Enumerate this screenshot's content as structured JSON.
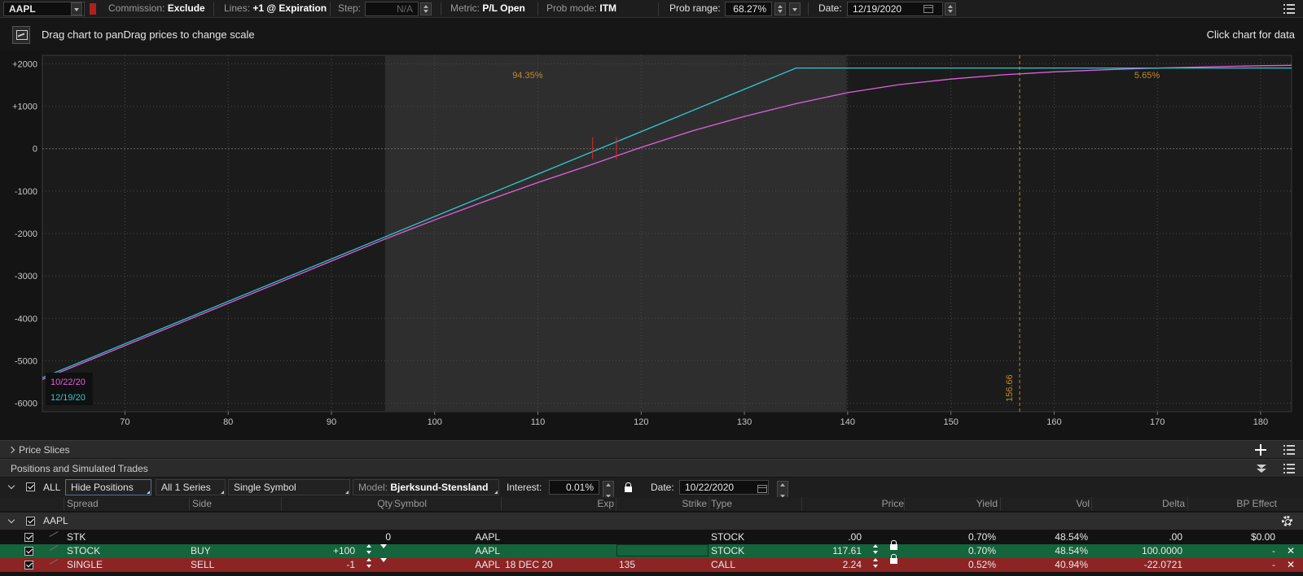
{
  "toolbar": {
    "symbol": "AAPL",
    "commission_label": "Commission:",
    "commission_value": "Exclude",
    "lines_label": "Lines:",
    "lines_value": "+1 @ Expiration",
    "step_label": "Step:",
    "step_value": "N/A",
    "metric_label": "Metric:",
    "metric_value": "P/L Open",
    "probmode_label": "Prob mode:",
    "probmode_value": "ITM",
    "probrange_label": "Prob range:",
    "probrange_value": "68.27%",
    "date_label": "Date:",
    "date_value": "12/19/2020"
  },
  "hint": {
    "left": "Drag chart to panDrag prices to change scale",
    "right": "Click chart for data"
  },
  "chart_data": {
    "type": "line",
    "xlim": [
      62,
      183
    ],
    "ylim": [
      -6200,
      2200
    ],
    "x_ticks": [
      70,
      80,
      90,
      100,
      110,
      120,
      130,
      140,
      150,
      160,
      170,
      180
    ],
    "y_ticks": [
      2000,
      1000,
      0,
      -1000,
      -2000,
      -3000,
      -4000,
      -5000,
      -6000
    ],
    "y_tick_labels": [
      "+2000",
      "+1000",
      "0",
      "-1000",
      "-2000",
      "-3000",
      "-4000",
      "-5000",
      "-6000"
    ],
    "prob_zone": [
      95.2,
      139.9
    ],
    "zone_labels": [
      {
        "text": "94.35%",
        "x": 109
      },
      {
        "text": "5.65%",
        "x": 169
      }
    ],
    "breakeven_marks": [
      {
        "x": 115.3,
        "y": 0
      },
      {
        "x": 117.6,
        "y": 0
      }
    ],
    "vertical_marker": {
      "x": 156.66,
      "label": "156.66"
    },
    "series": [
      {
        "name": "10/22/20",
        "color": "#e060e0",
        "x": [
          62,
          90,
          95,
          100,
          105,
          110,
          115,
          120,
          125,
          130,
          135,
          140,
          145,
          150,
          155,
          160,
          165,
          170,
          175,
          180,
          183
        ],
        "y": [
          -5440,
          -2650,
          -2150,
          -1680,
          -1230,
          -800,
          -390,
          30,
          420,
          760,
          1060,
          1320,
          1510,
          1640,
          1740,
          1810,
          1860,
          1900,
          1930,
          1955,
          1965
        ]
      },
      {
        "name": "12/19/20",
        "color": "#2ec8d0",
        "x": [
          62,
          135,
          183
        ],
        "y": [
          -5400,
          1900,
          1900
        ]
      }
    ]
  },
  "price_slices": {
    "label": "Price Slices"
  },
  "positions": {
    "title": "Positions and Simulated Trades",
    "all_label": "ALL",
    "hide_positions": "Hide Positions",
    "series": "All 1 Series",
    "single_symbol": "Single Symbol",
    "model_label": "Model:",
    "model_value": "Bjerksund-Stensland",
    "interest_label": "Interest:",
    "interest_value": "0.01%",
    "date_label": "Date:",
    "date_value": "10/22/2020",
    "columns": {
      "spread": "Spread",
      "side": "Side",
      "qty": "Qty",
      "symbol": "Symbol",
      "exp": "Exp",
      "strike": "Strike",
      "type": "Type",
      "price": "Price",
      "yield": "Yield",
      "vol": "Vol",
      "delta": "Delta",
      "bp": "BP Effect"
    },
    "group": "AAPL",
    "rows": [
      {
        "spread": "STK",
        "side": "",
        "qty": "0",
        "symbol": "AAPL",
        "exp": "",
        "strike": "",
        "type": "STOCK",
        "price": ".00",
        "yield": "0.70%",
        "vol": "48.54%",
        "delta": ".00",
        "bp": "$0.00"
      },
      {
        "spread": "STOCK",
        "side": "BUY",
        "qty": "+100",
        "symbol": "AAPL",
        "exp": "",
        "strike": "",
        "type": "STOCK",
        "price": "117.61",
        "yield": "0.70%",
        "vol": "48.54%",
        "delta": "100.0000",
        "bp": "-"
      },
      {
        "spread": "SINGLE",
        "side": "SELL",
        "qty": "-1",
        "symbol": "AAPL",
        "exp": "18 DEC 20",
        "strike": "135",
        "type": "CALL",
        "price": "2.24",
        "yield": "0.52%",
        "vol": "40.94%",
        "delta": "-22.0721",
        "bp": "-"
      }
    ]
  }
}
